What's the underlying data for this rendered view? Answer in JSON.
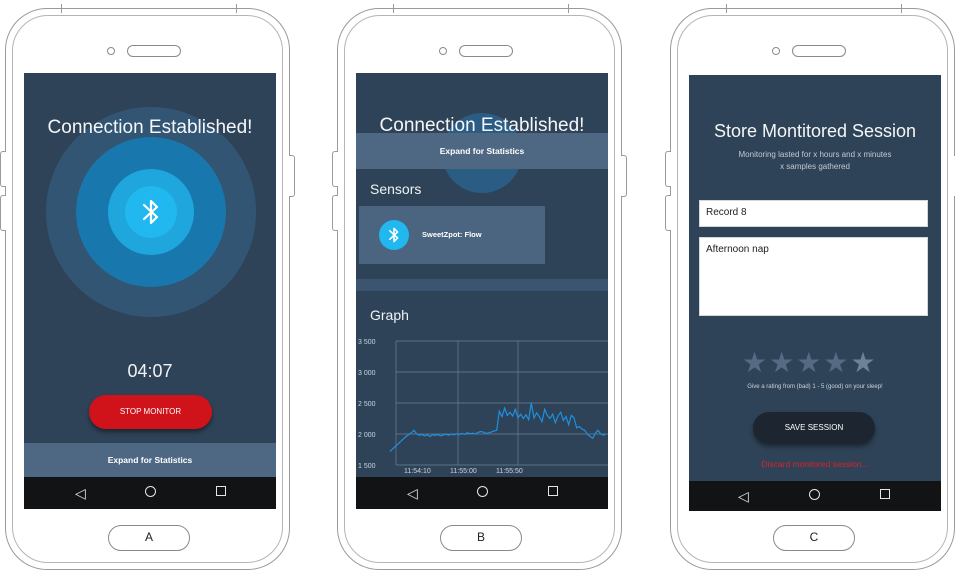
{
  "phones": [
    {
      "label": "A",
      "title": "Connection Established!",
      "timer": "04:07",
      "stop_button": "STOP MONITOR",
      "expand_bar": "Expand for Statistics"
    },
    {
      "label": "B",
      "title": "Connection Established!",
      "expand_bar": "Expand for Statistics",
      "sensors_title": "Sensors",
      "sensor_name": "SweetZpot: Flow",
      "graph_title": "Graph"
    },
    {
      "label": "C",
      "title": "Store Montitored Session",
      "subtitle_line1": "Monitoring lasted for x hours and x minutes",
      "subtitle_line2": "x samples gathered",
      "name_field": "Record 8",
      "notes_field": "Afternoon nap",
      "rating_hint": "Give a rating from (bad) 1 - 5 (good) on your sleep!",
      "save_button": "SAVE SESSION",
      "discard_link": "Discard monitored session..."
    }
  ],
  "nav_icons": [
    "back-icon",
    "home-circle-icon",
    "recents-square-icon"
  ],
  "icons": {
    "bluetooth": "bluetooth-icon"
  },
  "colors": {
    "screen_bg": "#2f4358",
    "accent_blue": "#20b8ee",
    "stop_red": "#d0121a",
    "graph_line": "#1e90e0",
    "expand_bar": "#4e6883"
  },
  "chart_data": {
    "type": "line",
    "title": "Graph",
    "yticks": [
      "3 500",
      "3 000",
      "2 500",
      "2 000",
      "1 500"
    ],
    "xticks": [
      "11:54:10",
      "11:55:00",
      "11:55:50"
    ],
    "ylim": [
      1500,
      3500
    ],
    "grid": true,
    "series": [
      {
        "color": "#1e90e0",
        "values": [
          [
            0,
            1720
          ],
          [
            2,
            1800
          ],
          [
            4,
            1880
          ],
          [
            6,
            1960
          ],
          [
            8,
            2020
          ],
          [
            9,
            2060
          ],
          [
            10,
            2000
          ],
          [
            11,
            1980
          ],
          [
            12,
            1990
          ],
          [
            13,
            1970
          ],
          [
            14,
            1985
          ],
          [
            15,
            1960
          ],
          [
            16,
            1990
          ],
          [
            17,
            1975
          ],
          [
            18,
            1990
          ],
          [
            19,
            1970
          ],
          [
            20,
            1985
          ],
          [
            21,
            1995
          ],
          [
            22,
            1980
          ],
          [
            23,
            2000
          ],
          [
            24,
            1985
          ],
          [
            25,
            2005
          ],
          [
            26,
            1990
          ],
          [
            27,
            2010
          ],
          [
            28,
            1995
          ],
          [
            29,
            2020
          ],
          [
            30,
            2005
          ],
          [
            31,
            2015
          ],
          [
            32,
            2000
          ],
          [
            33,
            2025
          ],
          [
            34,
            2040
          ],
          [
            35,
            2030
          ],
          [
            36,
            2010
          ],
          [
            37,
            2020
          ],
          [
            38,
            2030
          ],
          [
            39,
            2050
          ],
          [
            40,
            2060
          ],
          [
            41,
            2370
          ],
          [
            42,
            2280
          ],
          [
            43,
            2420
          ],
          [
            44,
            2300
          ],
          [
            45,
            2350
          ],
          [
            46,
            2290
          ],
          [
            47,
            2400
          ],
          [
            48,
            2260
          ],
          [
            49,
            2320
          ],
          [
            50,
            2250
          ],
          [
            51,
            2310
          ],
          [
            52,
            2230
          ],
          [
            53,
            2500
          ],
          [
            54,
            2260
          ],
          [
            55,
            2340
          ],
          [
            56,
            2280
          ],
          [
            57,
            2200
          ],
          [
            58,
            2400
          ],
          [
            59,
            2300
          ],
          [
            60,
            2250
          ],
          [
            61,
            2320
          ],
          [
            62,
            2180
          ],
          [
            63,
            2290
          ],
          [
            64,
            2350
          ],
          [
            65,
            2220
          ],
          [
            66,
            2280
          ],
          [
            67,
            2150
          ],
          [
            68,
            2300
          ],
          [
            69,
            2260
          ],
          [
            70,
            2100
          ],
          [
            71,
            2120
          ],
          [
            72,
            2080
          ],
          [
            73,
            2060
          ],
          [
            74,
            2000
          ],
          [
            75,
            1960
          ],
          [
            76,
            1930
          ],
          [
            77,
            2010
          ],
          [
            78,
            2060
          ],
          [
            79,
            2000
          ],
          [
            80,
            1980
          ],
          [
            81,
            2000
          ]
        ]
      }
    ]
  }
}
